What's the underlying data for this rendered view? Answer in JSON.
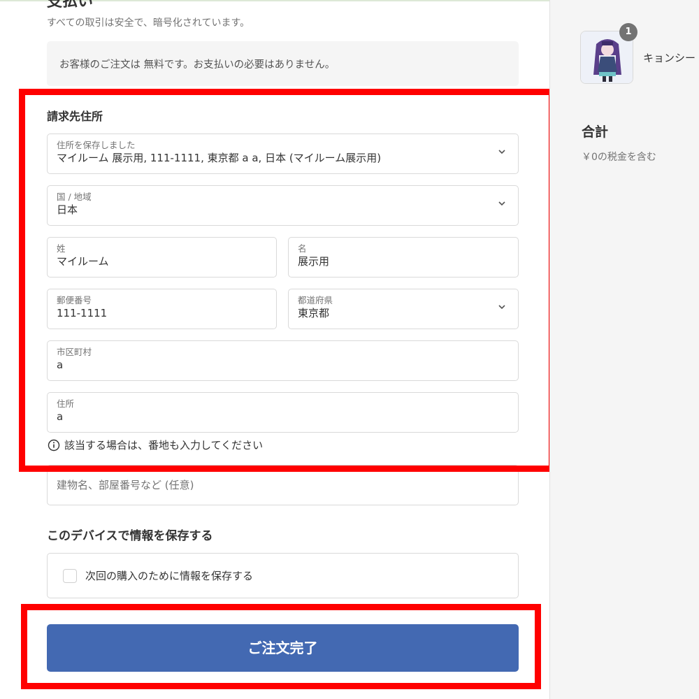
{
  "colors": {
    "accent": "#4369b2",
    "highlight": "#ff0000",
    "sidebar_bg": "#f5f5f5",
    "badge_bg": "#737373"
  },
  "payment": {
    "heading": "支払い",
    "subtitle": "すべての取引は安全で、暗号化されています。",
    "free_notice": "お客様のご注文は 無料です。お支払いの必要はありません。"
  },
  "billing": {
    "title": "請求先住所",
    "saved_address": {
      "label": "住所を保存しました",
      "value": "マイルーム 展示用, 111-1111, 東京都 a a, 日本 (マイルーム展示用)"
    },
    "country": {
      "label": "国 / 地域",
      "value": "日本"
    },
    "last_name": {
      "label": "姓",
      "value": "マイルーム"
    },
    "first_name": {
      "label": "名",
      "value": "展示用"
    },
    "postal_code": {
      "label": "郵便番号",
      "value": "111-1111"
    },
    "prefecture": {
      "label": "都道府県",
      "value": "東京都"
    },
    "city": {
      "label": "市区町村",
      "value": "a"
    },
    "address": {
      "label": "住所",
      "value": "a"
    },
    "hint": "該当する場合は、番地も入力してください",
    "apartment_placeholder": "建物名、部屋番号など (任意)"
  },
  "save_info": {
    "title": "このデバイスで情報を保存する",
    "checkbox_label": "次回の購入のために情報を保存する",
    "checked": false
  },
  "submit_label": "ご注文完了",
  "sidebar": {
    "product_qty": "1",
    "product_name": "キョンシー",
    "total_label": "合計",
    "tax_note": "￥0の税金を含む"
  },
  "icons": [
    "chevron-down-icon",
    "info-icon",
    "product-thumbnail"
  ]
}
